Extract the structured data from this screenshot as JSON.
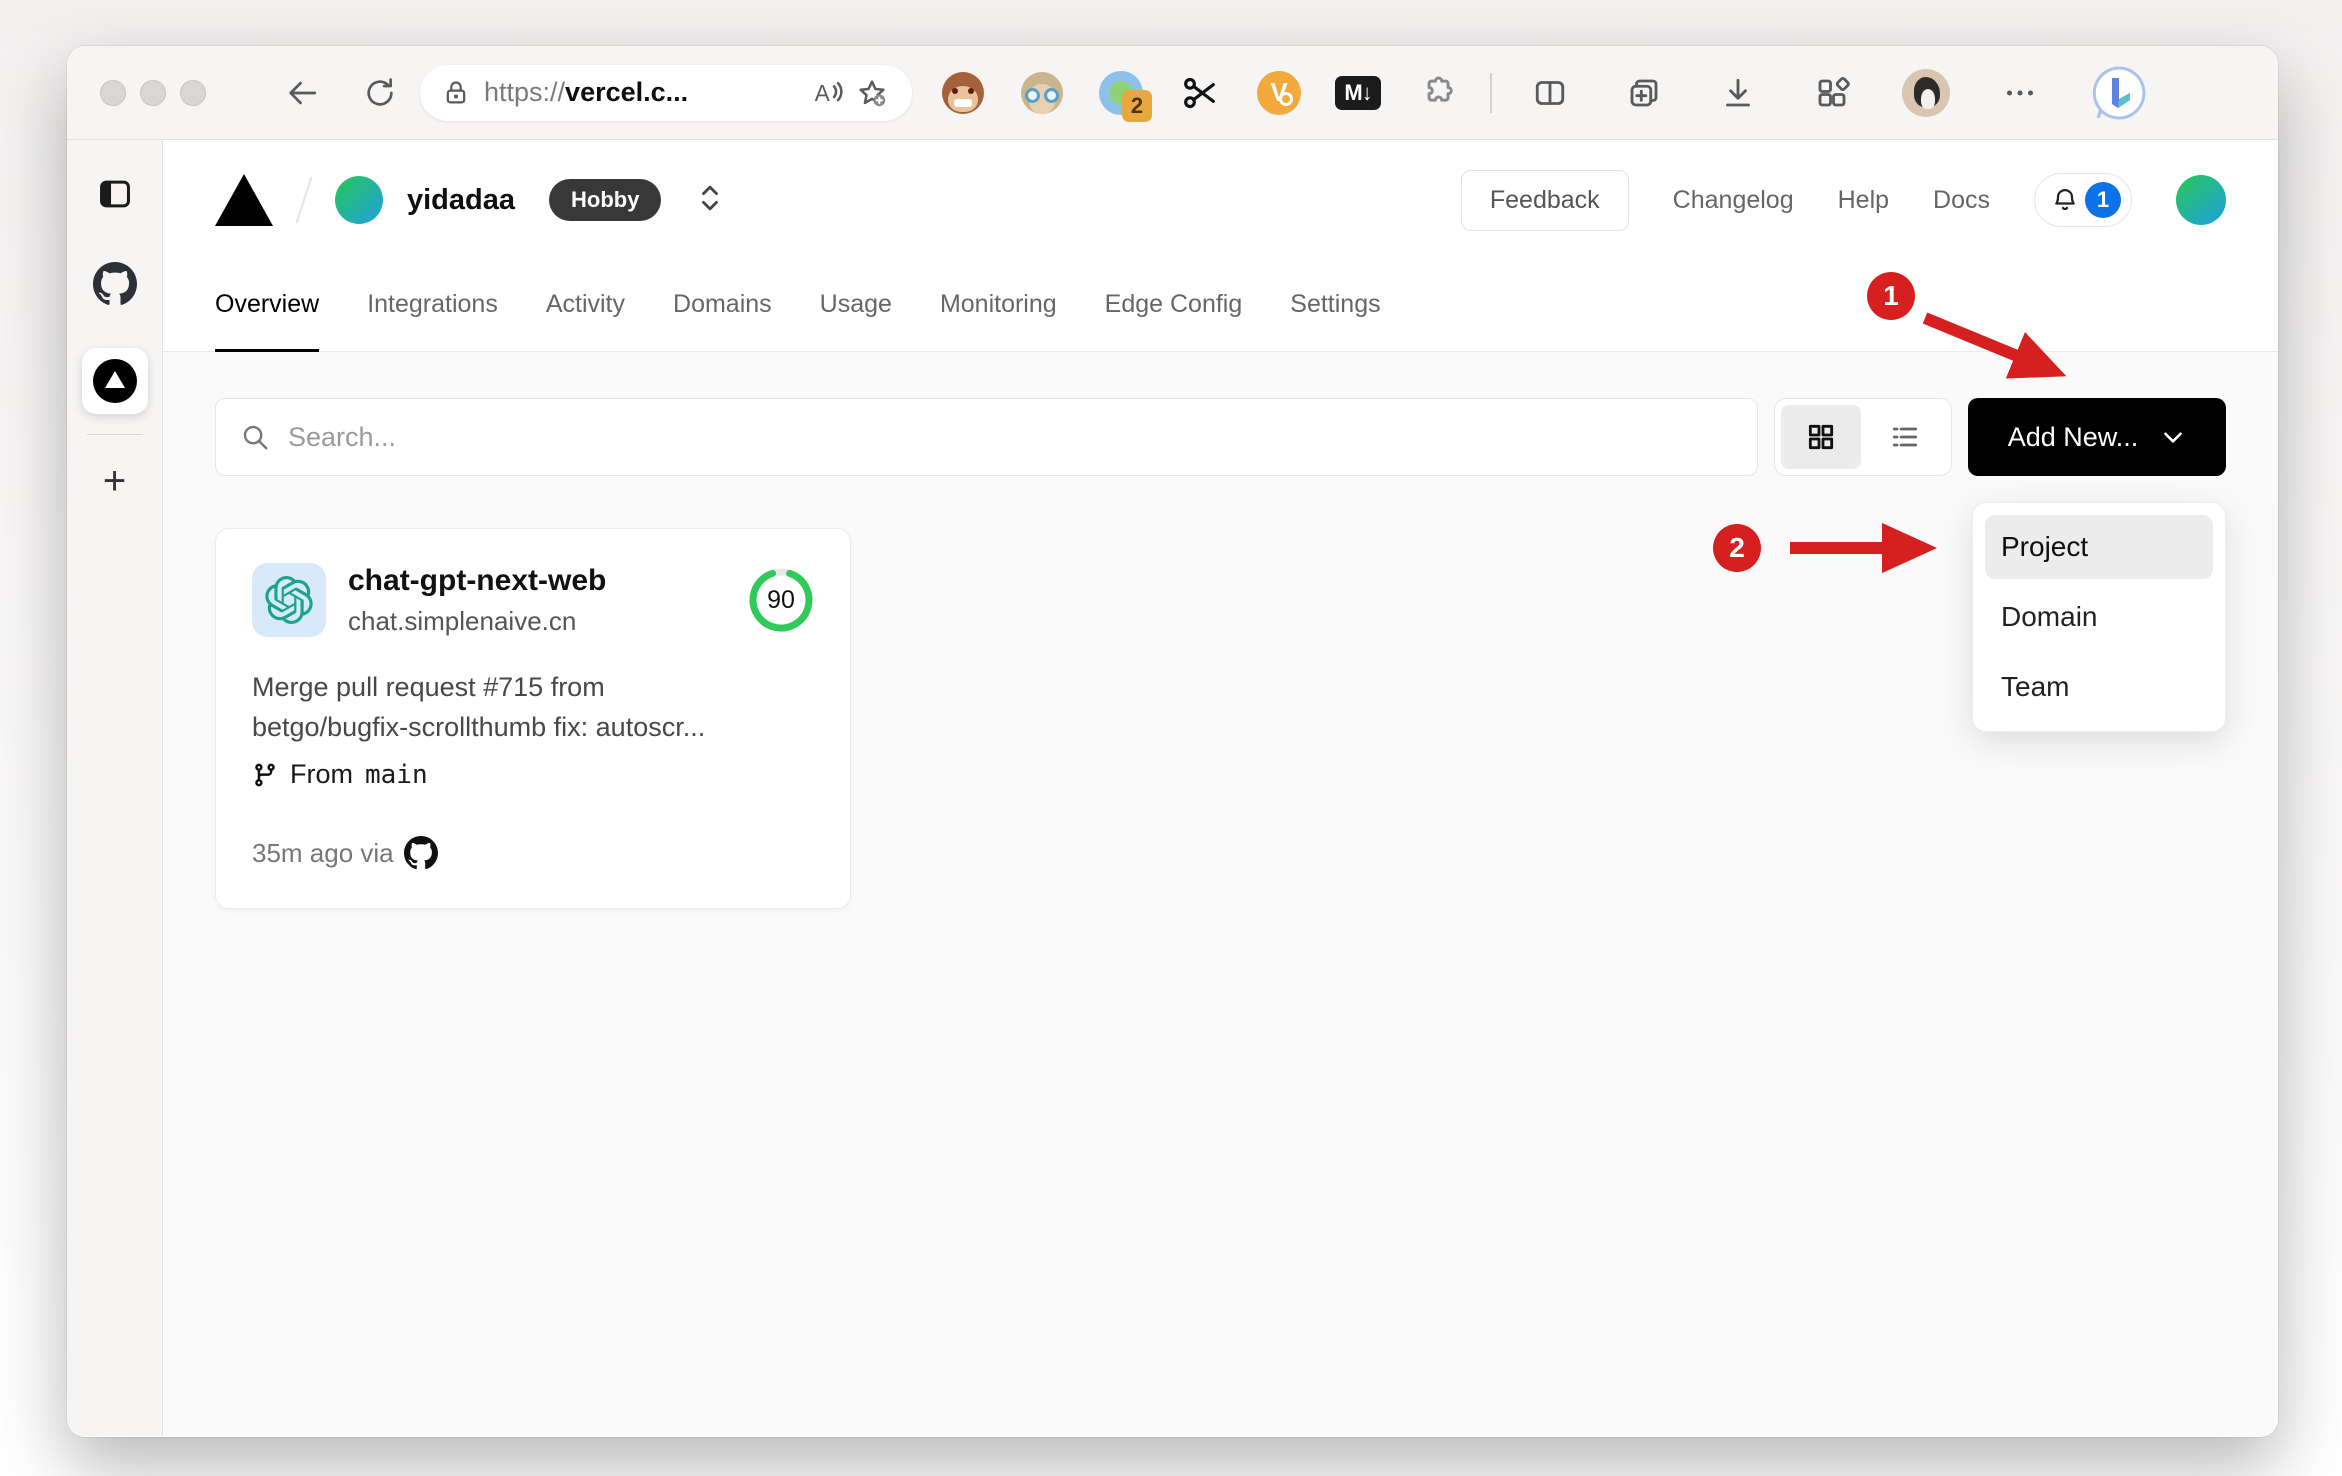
{
  "browser": {
    "url_scheme": "https://",
    "url_host": "vercel.c...",
    "extension_badge_count": "2",
    "markdown_ext_label": "M↓"
  },
  "header": {
    "team_name": "yidadaa",
    "plan_badge": "Hobby",
    "feedback_label": "Feedback",
    "links": [
      "Changelog",
      "Help",
      "Docs"
    ],
    "notification_count": "1"
  },
  "tabs": {
    "items": [
      {
        "label": "Overview",
        "active": true
      },
      {
        "label": "Integrations",
        "active": false
      },
      {
        "label": "Activity",
        "active": false
      },
      {
        "label": "Domains",
        "active": false
      },
      {
        "label": "Usage",
        "active": false
      },
      {
        "label": "Monitoring",
        "active": false
      },
      {
        "label": "Edge Config",
        "active": false
      },
      {
        "label": "Settings",
        "active": false
      }
    ]
  },
  "toolbar": {
    "search_placeholder": "Search...",
    "add_new_label": "Add New..."
  },
  "dropdown": {
    "highlighted": "Project",
    "items": [
      "Project",
      "Domain",
      "Team"
    ]
  },
  "project_card": {
    "name": "chat-gpt-next-web",
    "domain": "chat.simplenaive.cn",
    "score": "90",
    "commit_line1": "Merge pull request #715 from",
    "commit_line2": "betgo/bugfix-scrollthumb fix: autoscr...",
    "branch_prefix": "From",
    "branch_name": "main",
    "deploy_meta": "35m ago via"
  },
  "annotations": {
    "step1": "1",
    "step2": "2"
  },
  "colors": {
    "annotation_red": "#d61f1f",
    "score_green": "#2fca5a",
    "notification_blue": "#0b72e8",
    "openai_teal": "#1aa390",
    "add_new_black": "#000000"
  }
}
